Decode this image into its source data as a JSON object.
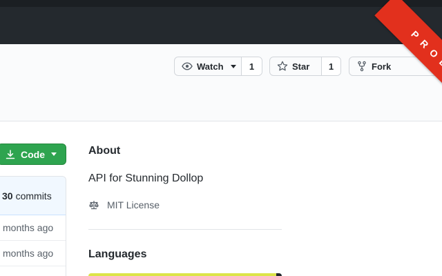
{
  "header": {
    "user_avatar": "avatar",
    "avatar_menu_icon": "caret-down-icon"
  },
  "repo_actions": {
    "watch": {
      "label": "Watch",
      "count": "1",
      "icon": "eye-icon"
    },
    "star": {
      "label": "Star",
      "count": "1",
      "icon": "star-icon"
    },
    "fork": {
      "label": "Fork",
      "icon": "repo-forked-icon"
    }
  },
  "ribbon": {
    "label": "PROD",
    "color": "#e2301d"
  },
  "code_button": {
    "label": "Code",
    "icon": "download-icon",
    "color": "#2ea44f"
  },
  "file_list": {
    "commit_count": "30",
    "commit_label": "commits",
    "rows": [
      {
        "age": "months ago"
      },
      {
        "age": "months ago"
      }
    ]
  },
  "about": {
    "title": "About",
    "description": "API for Stunning Dollop",
    "license": {
      "label": "MIT License",
      "icon": "law-icon"
    }
  },
  "languages": {
    "title": "Languages",
    "bar_colors": [
      "#dce448",
      "#24292e"
    ]
  }
}
